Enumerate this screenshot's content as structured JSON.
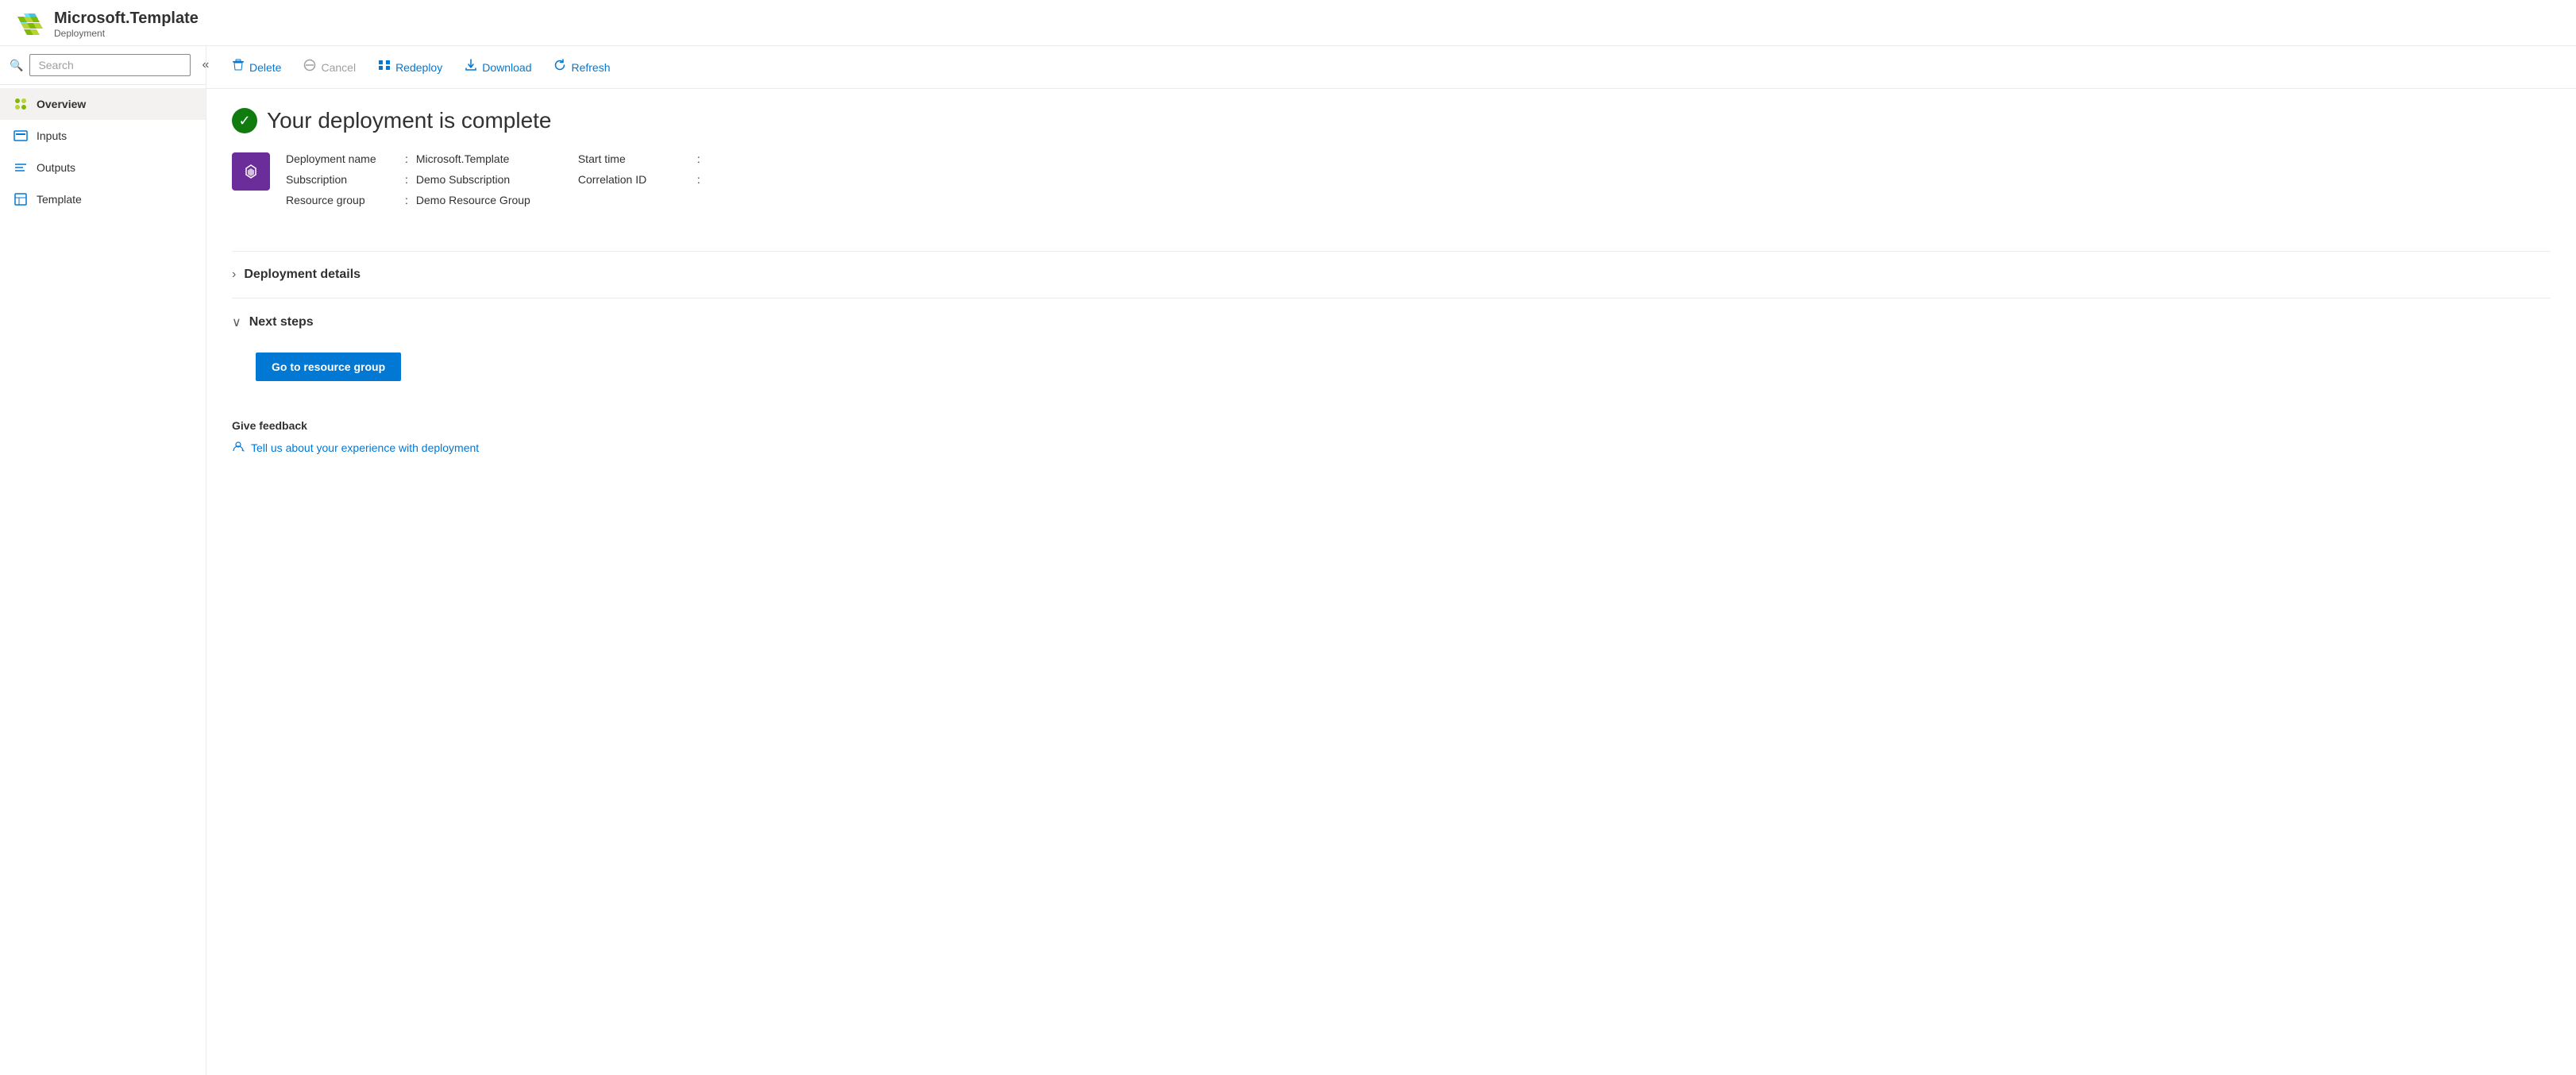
{
  "header": {
    "title": "Microsoft.Template",
    "subtitle": "Deployment",
    "logo_alt": "Azure Logo"
  },
  "search": {
    "placeholder": "Search"
  },
  "collapse_btn": "«",
  "nav": {
    "items": [
      {
        "id": "overview",
        "label": "Overview",
        "icon": "overview-icon",
        "active": true
      },
      {
        "id": "inputs",
        "label": "Inputs",
        "icon": "inputs-icon",
        "active": false
      },
      {
        "id": "outputs",
        "label": "Outputs",
        "icon": "outputs-icon",
        "active": false
      },
      {
        "id": "template",
        "label": "Template",
        "icon": "template-icon",
        "active": false
      }
    ]
  },
  "toolbar": {
    "buttons": [
      {
        "id": "delete",
        "label": "Delete",
        "icon": "delete-icon",
        "disabled": false
      },
      {
        "id": "cancel",
        "label": "Cancel",
        "icon": "cancel-icon",
        "disabled": true
      },
      {
        "id": "redeploy",
        "label": "Redeploy",
        "icon": "redeploy-icon",
        "disabled": false
      },
      {
        "id": "download",
        "label": "Download",
        "icon": "download-icon",
        "disabled": false
      },
      {
        "id": "refresh",
        "label": "Refresh",
        "icon": "refresh-icon",
        "disabled": false
      }
    ]
  },
  "deployment": {
    "status_message": "Your deployment is complete",
    "info": {
      "name_label": "Deployment name",
      "name_value": "Microsoft.Template",
      "subscription_label": "Subscription",
      "subscription_value": "Demo Subscription",
      "resource_group_label": "Resource group",
      "resource_group_value": "Demo Resource Group",
      "start_time_label": "Start time",
      "start_time_value": "",
      "correlation_id_label": "Correlation ID",
      "correlation_id_value": ""
    },
    "deployment_details_label": "Deployment details",
    "next_steps_label": "Next steps",
    "go_to_resource_group_label": "Go to resource group"
  },
  "feedback": {
    "title": "Give feedback",
    "link_text": "Tell us about your experience with deployment"
  }
}
